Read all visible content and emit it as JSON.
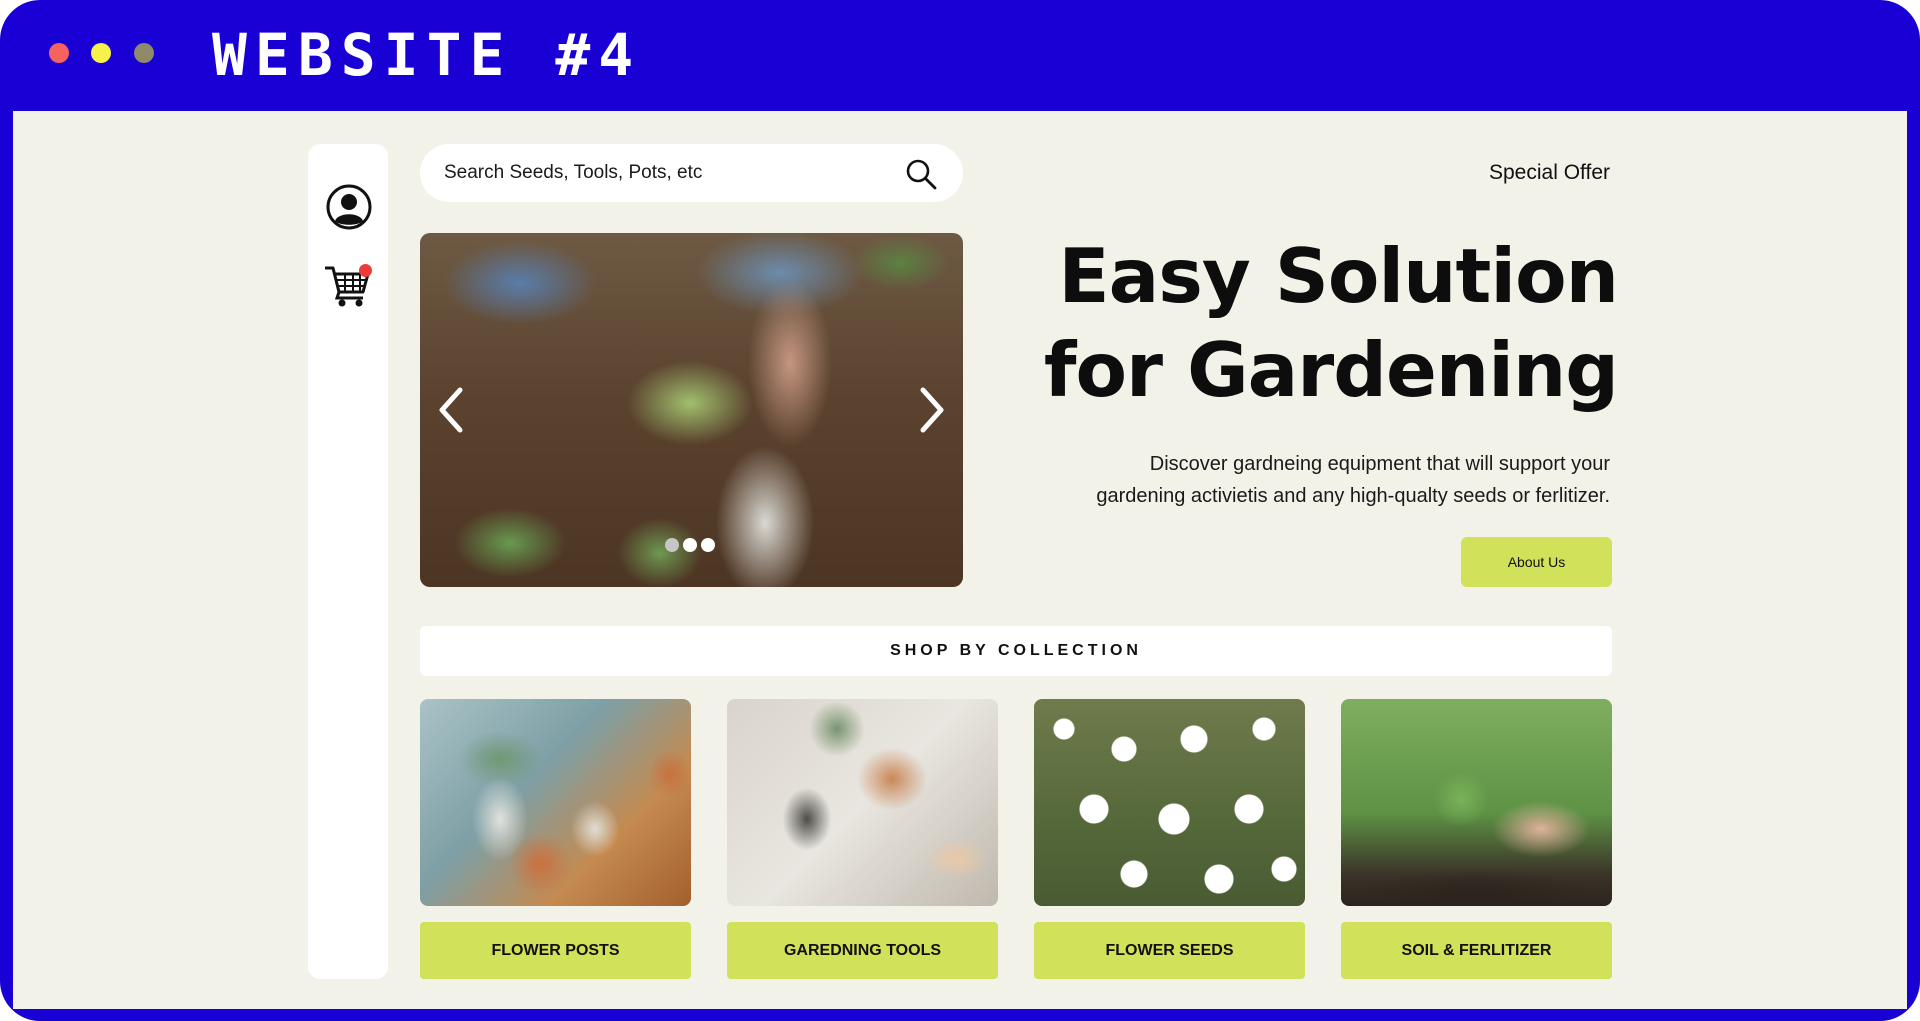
{
  "window": {
    "title": "WEBSITE #4",
    "controls": [
      "close",
      "minimize",
      "zoom"
    ]
  },
  "sidebar": {
    "icons": [
      "user-icon",
      "cart-icon"
    ],
    "cart_has_notification": true
  },
  "search": {
    "placeholder": "Search Seeds, Tools, Pots, etc",
    "icon": "search-icon"
  },
  "header": {
    "special_offer": "Special Offer"
  },
  "carousel": {
    "slide_count": 3,
    "active_slide": 1,
    "prev_icon": "chevron-left-icon",
    "next_icon": "chevron-right-icon"
  },
  "hero": {
    "title_line1": "Easy Solution",
    "title_line2": "for Gardening",
    "desc_line1": "Discover gardneing equipment that will support your",
    "desc_line2": "gardening activietis and any high-qualty seeds or ferlitizer.",
    "about_label": "About Us"
  },
  "collection": {
    "heading": "SHOP BY COLLECTION",
    "items": [
      {
        "label": "FLOWER POSTS"
      },
      {
        "label": "GAREDNING TOOLS"
      },
      {
        "label": "FLOWER SEEDS"
      },
      {
        "label": "SOIL & FERLITIZER"
      }
    ]
  },
  "colors": {
    "frame": "#1900d5",
    "page_bg": "#f3f2e9",
    "accent": "#d2e15a",
    "badge": "#ee3a38"
  }
}
